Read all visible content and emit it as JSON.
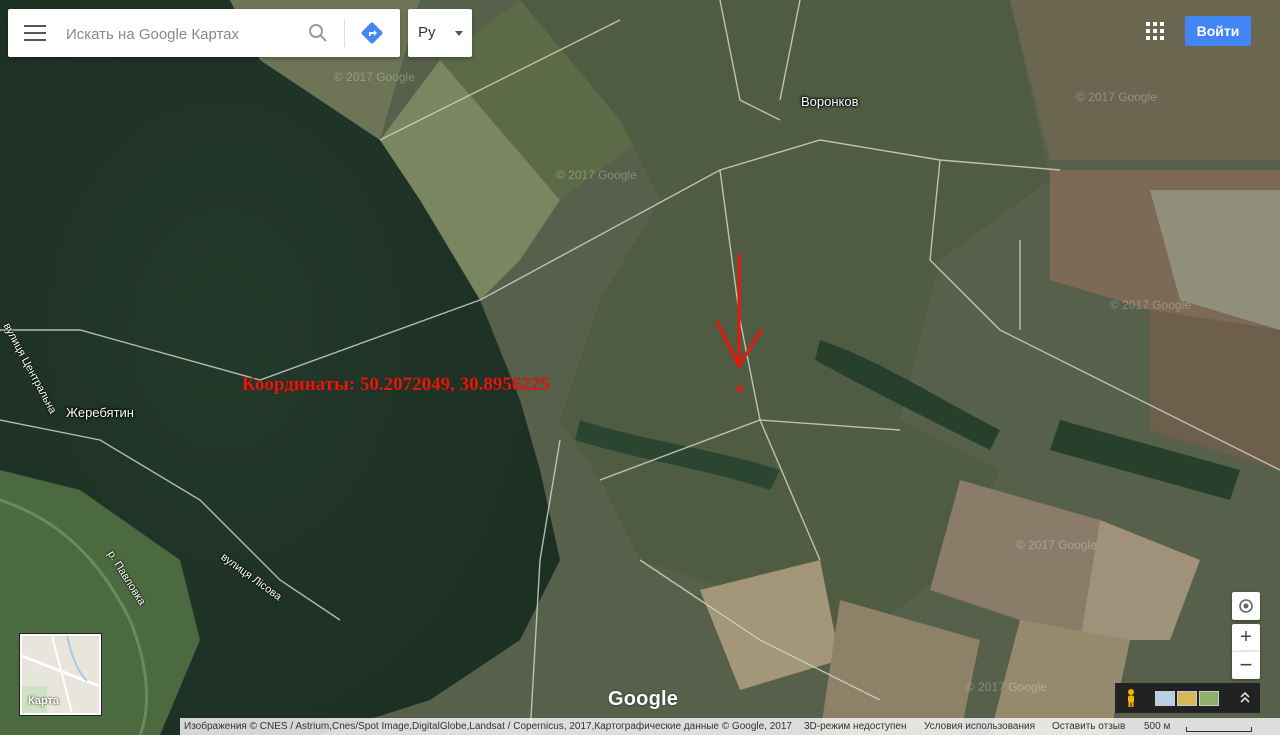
{
  "search": {
    "placeholder": "Искать на Google Картах"
  },
  "language": {
    "label": "Ру"
  },
  "header": {
    "signin_label": "Войти"
  },
  "annotation": {
    "coordinates_text": "Координаты: 50.2072049, 30.8956225"
  },
  "places": {
    "village_north": "Воронков",
    "village_west": "Жеребятин"
  },
  "streets": {
    "central": "вулиця Центральна",
    "forest": "вулиця Лісова",
    "river": "р. Павловка"
  },
  "watermarks": [
    "© 2017 Google",
    "© 2017 Google",
    "© 2017 Google",
    "© 2017 Google",
    "© 2017 Google",
    "© 2017 Google"
  ],
  "minimap": {
    "label": "Карта"
  },
  "brand": {
    "logo_text": "Google"
  },
  "controls": {
    "zoom_in": "+",
    "zoom_out": "−"
  },
  "footer": {
    "imagery": "Изображения © CNES / Astrium,Cnes/Spot Image,DigitalGlobe,Landsat / Copernicus, 2017,Картографические данные © Google, 2017",
    "three_d": "3D-режим недоступен",
    "terms": "Условия использования",
    "feedback": "Оставить отзыв",
    "scale": "500 м"
  },
  "colors": {
    "annotation_red": "#e8160c",
    "signin_blue": "#4285f4",
    "directions_blue": "#4285f4"
  },
  "icons": [
    "menu-icon",
    "search-icon",
    "directions-icon",
    "apps-icon",
    "locate-icon",
    "pegman-icon",
    "expand-icon"
  ]
}
